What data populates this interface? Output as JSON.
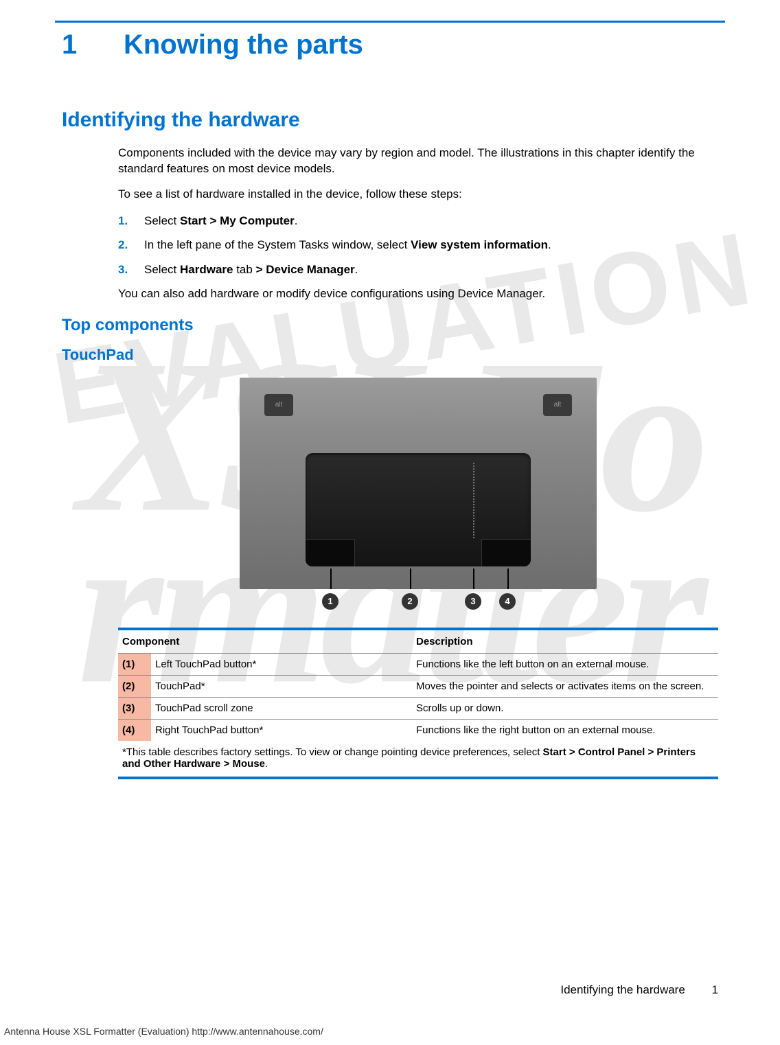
{
  "watermark": {
    "line1": "XSLFo",
    "line2": "rmatter",
    "eval": "EVALUATION"
  },
  "chapter": {
    "num": "1",
    "title": "Knowing the parts"
  },
  "section1": {
    "heading": "Identifying the hardware",
    "p1": "Components included with the device may vary by region and model. The illustrations in this chapter identify the standard features on most device models.",
    "p2": "To see a list of hardware installed in the device, follow these steps:",
    "steps": [
      {
        "num": "1.",
        "pre": "Select ",
        "bold": "Start > My Computer",
        "post": "."
      },
      {
        "num": "2.",
        "pre": "In the left pane of the System Tasks window, select ",
        "bold": "View system information",
        "post": "."
      },
      {
        "num": "3.",
        "pre": "Select ",
        "bold": "Hardware",
        "mid": " tab ",
        "bold2": "> Device Manager",
        "post": "."
      }
    ],
    "p3": "You can also add hardware or modify device configurations using Device Manager."
  },
  "section2": {
    "heading": "Top components"
  },
  "section3": {
    "heading": "TouchPad"
  },
  "figure": {
    "callouts": [
      "1",
      "2",
      "3",
      "4"
    ],
    "keylabel": "alt"
  },
  "table": {
    "head": {
      "component": "Component",
      "description": "Description"
    },
    "rows": [
      {
        "n": "(1)",
        "c": "Left TouchPad button*",
        "d": "Functions like the left button on an external mouse."
      },
      {
        "n": "(2)",
        "c": "TouchPad*",
        "d": "Moves the pointer and selects or activates items on the screen."
      },
      {
        "n": "(3)",
        "c": "TouchPad scroll zone",
        "d": "Scrolls up or down."
      },
      {
        "n": "(4)",
        "c": "Right TouchPad button*",
        "d": "Functions like the right button on an external mouse."
      }
    ],
    "note_pre": "*This table describes factory settings. To view or change pointing device preferences, select ",
    "note_bold": "Start > Control Panel > Printers and Other Hardware > Mouse",
    "note_post": "."
  },
  "footer": {
    "section": "Identifying the hardware",
    "page": "1"
  },
  "evalfooter": "Antenna House XSL Formatter (Evaluation)  http://www.antennahouse.com/"
}
